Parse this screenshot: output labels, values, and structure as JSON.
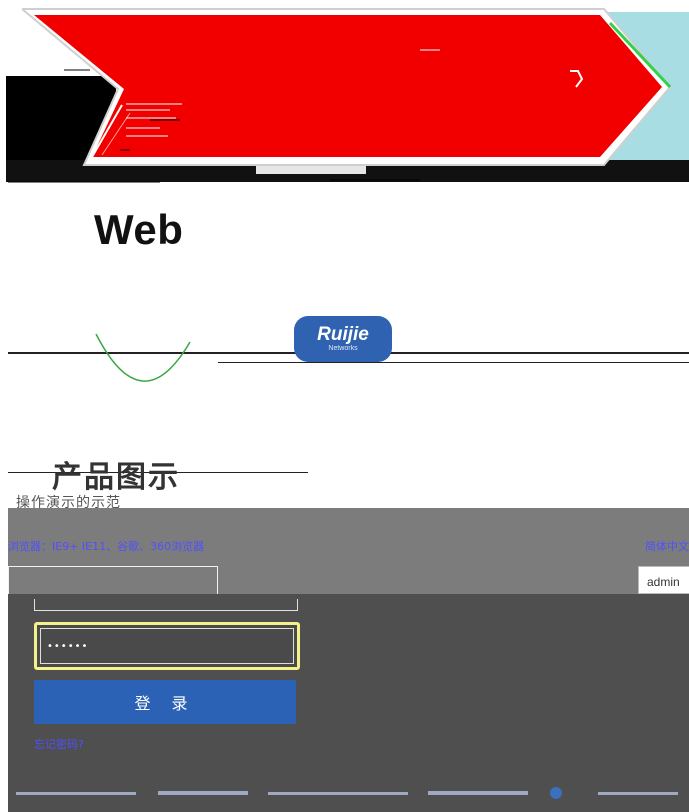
{
  "heading": {
    "title": "Web"
  },
  "logo": {
    "brand": "Ruijie",
    "tagline": "Networks"
  },
  "hero": {
    "title": "产品图示",
    "subtitle": "操作演示的示范"
  },
  "login": {
    "browser_note": "浏览器：IE9+ IE11、谷歌、360浏览器",
    "language_note": "简体中文",
    "username_value": "admin",
    "password_value": "••••••",
    "login_button_label": "登 录",
    "forgot_password_label": "忘记密码?"
  },
  "colors": {
    "banner_red": "#f20000",
    "banner_teal": "#a8dde3",
    "brand_blue": "#2c62b6",
    "link_blue": "#5050ff",
    "focus_yellow": "#f6f08a"
  }
}
